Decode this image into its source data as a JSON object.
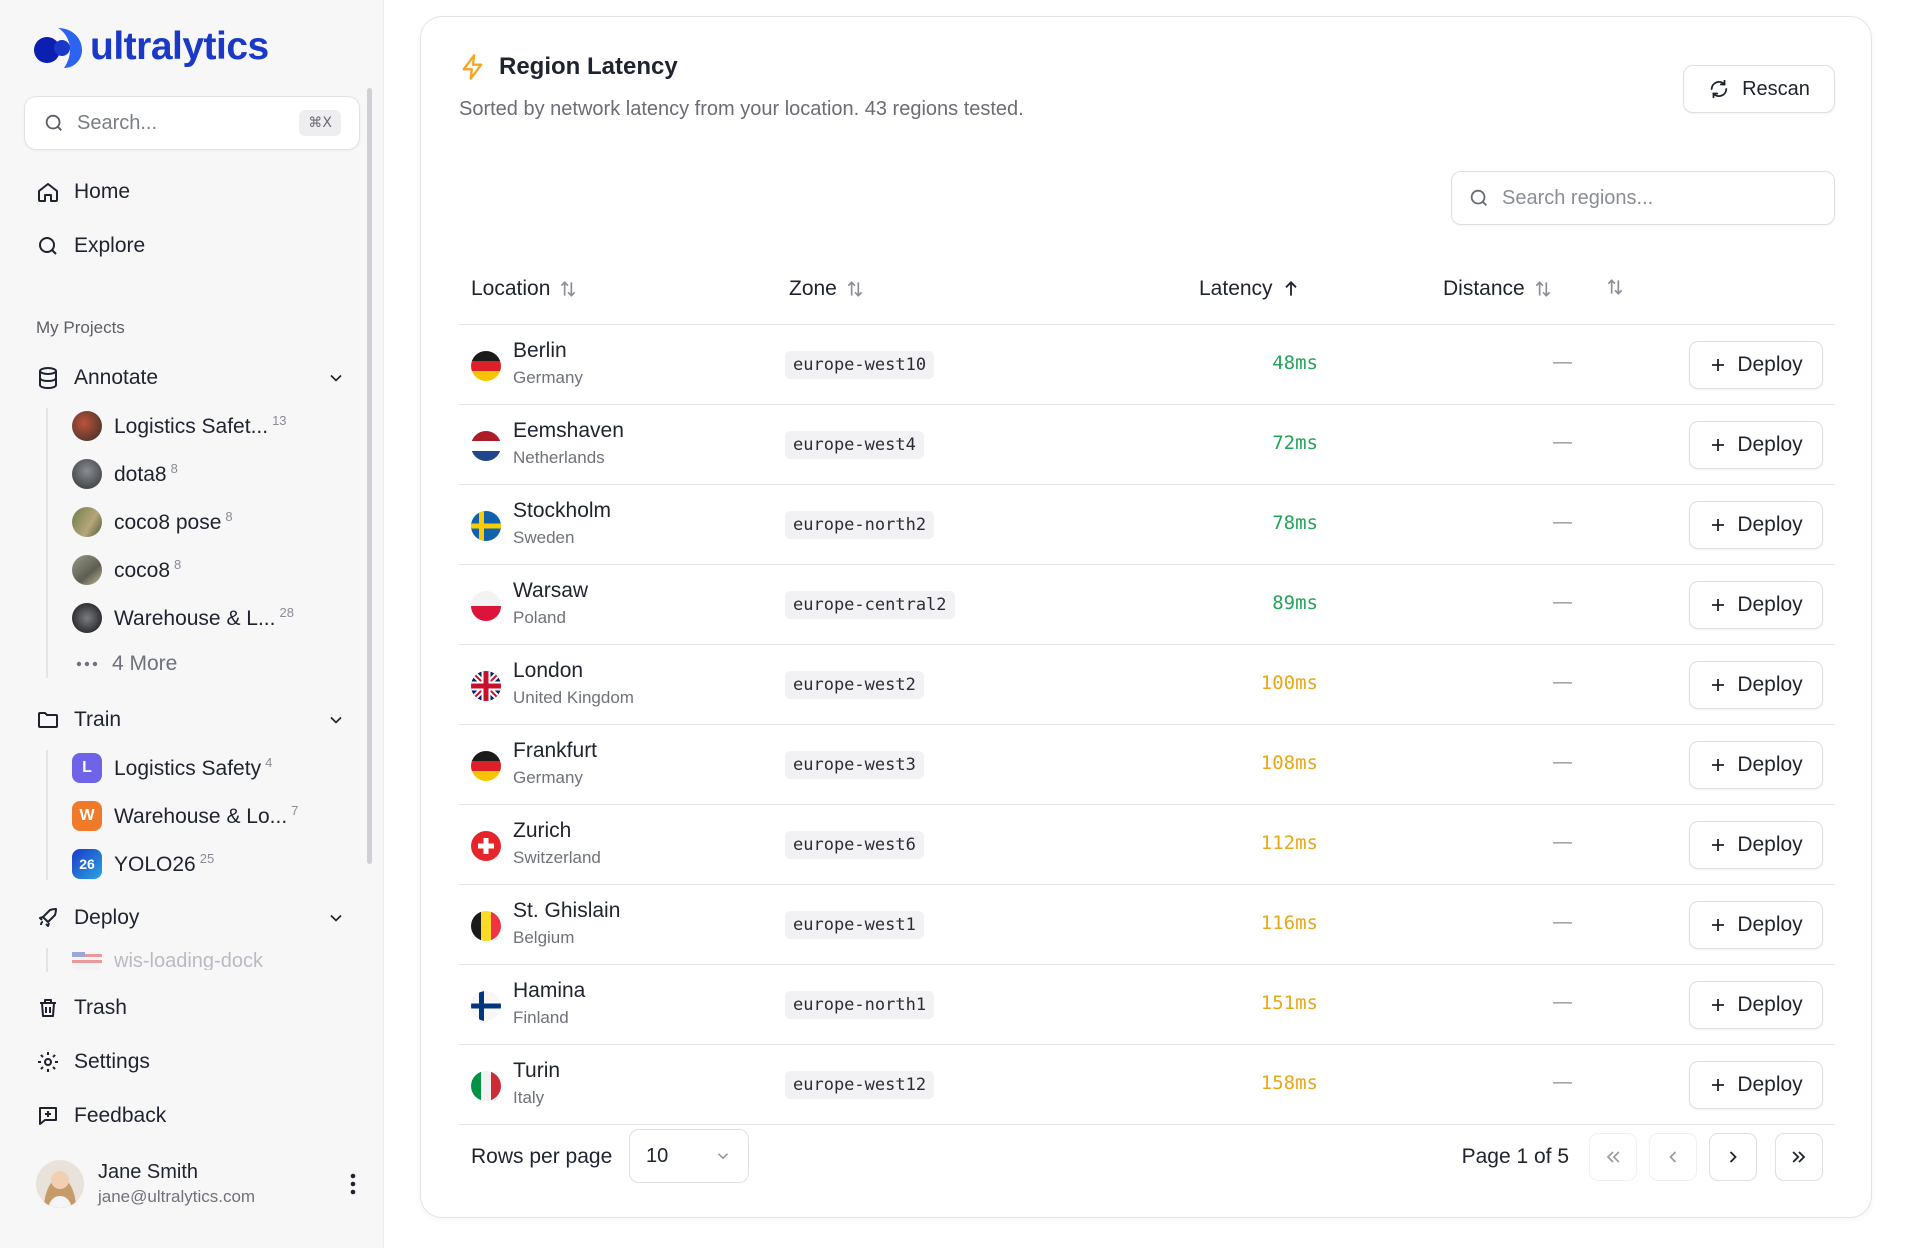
{
  "app": {
    "brand": "ultralytics"
  },
  "sidebar": {
    "search": {
      "placeholder": "Search...",
      "shortcut": "⌘X"
    },
    "nav": [
      {
        "label": "Home",
        "icon": "home-icon"
      },
      {
        "label": "Explore",
        "icon": "search-icon"
      }
    ],
    "section_label": "My Projects",
    "annotate": {
      "label": "Annotate",
      "items": [
        {
          "label": "Logistics Safet...",
          "count": "13"
        },
        {
          "label": "dota8",
          "count": "8"
        },
        {
          "label": "coco8 pose",
          "count": "8"
        },
        {
          "label": "coco8",
          "count": "8"
        },
        {
          "label": "Warehouse & L...",
          "count": "28"
        }
      ],
      "more_label": "4 More"
    },
    "train": {
      "label": "Train",
      "items": [
        {
          "label": "Logistics Safety",
          "count": "4",
          "badge": "L"
        },
        {
          "label": "Warehouse & Lo...",
          "count": "7",
          "badge": "W"
        },
        {
          "label": "YOLO26",
          "count": "25",
          "badge": "26"
        }
      ]
    },
    "deploy": {
      "label": "Deploy",
      "partial_item": "wis-loading-dock"
    },
    "bottom_nav": [
      {
        "label": "Trash",
        "icon": "trash-icon"
      },
      {
        "label": "Settings",
        "icon": "gear-icon"
      },
      {
        "label": "Feedback",
        "icon": "feedback-icon"
      }
    ],
    "user": {
      "name": "Jane Smith",
      "email": "jane@ultralytics.com"
    }
  },
  "main": {
    "title": "Region Latency",
    "subtitle": "Sorted by network latency from your location. 43 regions tested.",
    "rescan_label": "Rescan",
    "search_placeholder": "Search regions...",
    "columns": {
      "location": "Location",
      "zone": "Zone",
      "latency": "Latency",
      "distance": "Distance"
    },
    "deploy_label": "Deploy",
    "rows": [
      {
        "city": "Berlin",
        "country": "Germany",
        "zone": "europe-west10",
        "latency": "48ms",
        "distance": "—"
      },
      {
        "city": "Eemshaven",
        "country": "Netherlands",
        "zone": "europe-west4",
        "latency": "72ms",
        "distance": "—"
      },
      {
        "city": "Stockholm",
        "country": "Sweden",
        "zone": "europe-north2",
        "latency": "78ms",
        "distance": "—"
      },
      {
        "city": "Warsaw",
        "country": "Poland",
        "zone": "europe-central2",
        "latency": "89ms",
        "distance": "—"
      },
      {
        "city": "London",
        "country": "United Kingdom",
        "zone": "europe-west2",
        "latency": "100ms",
        "distance": "—"
      },
      {
        "city": "Frankfurt",
        "country": "Germany",
        "zone": "europe-west3",
        "latency": "108ms",
        "distance": "—"
      },
      {
        "city": "Zurich",
        "country": "Switzerland",
        "zone": "europe-west6",
        "latency": "112ms",
        "distance": "—"
      },
      {
        "city": "St. Ghislain",
        "country": "Belgium",
        "zone": "europe-west1",
        "latency": "116ms",
        "distance": "—"
      },
      {
        "city": "Hamina",
        "country": "Finland",
        "zone": "europe-north1",
        "latency": "151ms",
        "distance": "—"
      },
      {
        "city": "Turin",
        "country": "Italy",
        "zone": "europe-west12",
        "latency": "158ms",
        "distance": "—"
      }
    ],
    "footer": {
      "rows_per_page_label": "Rows per page",
      "rows_per_page_value": "10",
      "page_label": "Page 1 of 5"
    }
  },
  "colors": {
    "brand": "#1a39c9",
    "latency_good": "#22a35a",
    "latency_warn": "#e6a817",
    "accent_bolt": "#f5a623"
  }
}
